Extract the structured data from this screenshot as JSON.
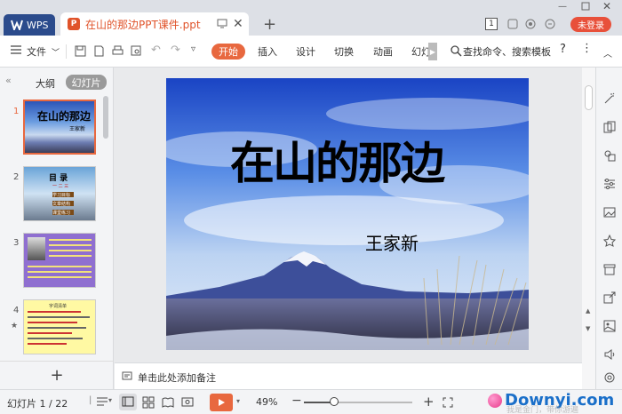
{
  "titlebar": {
    "wps_label": "WPS",
    "doc_title": "在山的那边PPT课件.ppt",
    "badge": "1",
    "login_label": "未登录"
  },
  "toolbar": {
    "file_label": "文件",
    "items": [
      "开始",
      "插入",
      "设计",
      "切换",
      "动画",
      "幻灯"
    ],
    "search_label": "查找命令、搜索模板",
    "help": "?"
  },
  "leftpanel": {
    "tabs": [
      "大纲",
      "幻灯片"
    ],
    "slide_numbers": [
      "1",
      "2",
      "3",
      "4"
    ],
    "add": "+",
    "thumb1": {
      "title": "在山的那边",
      "author": "王家新"
    },
    "thumb2": {
      "title": "目 录",
      "items": [
        "一 二 三",
        "学习目标",
        "文章结构",
        "课堂练习"
      ]
    },
    "thumb4": {
      "title": "字词清单"
    }
  },
  "slide": {
    "title": "在山的那边",
    "author": "王家新"
  },
  "notes": {
    "placeholder": "单击此处添加备注"
  },
  "statusbar": {
    "slide_info": "幻灯片 1 / 22",
    "zoom": "49%",
    "minus": "−",
    "plus": "+"
  },
  "watermark": {
    "text": "Downyi.com",
    "sub": "我是金门，带你游遍"
  },
  "colors": {
    "accent": "#e8683f",
    "wps_blue": "#2b4b8c",
    "login": "#e8503a"
  }
}
